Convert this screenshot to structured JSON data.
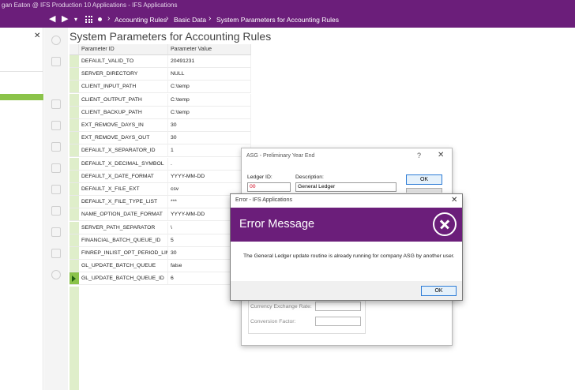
{
  "window": {
    "title": "gan Eaton @ IFS Production 10 Applications - IFS Applications"
  },
  "nav": {
    "breadcrumbs": [
      "Accounting Rules",
      "Basic Data",
      "System Parameters for Accounting Rules"
    ]
  },
  "page": {
    "title": "System Parameters for Accounting Rules"
  },
  "grid": {
    "columns": [
      "Parameter ID",
      "Parameter Value"
    ],
    "rows": [
      {
        "id": "DEFAULT_VALID_TO",
        "value": "20491231"
      },
      {
        "id": "SERVER_DIRECTORY",
        "value": "NULL"
      },
      {
        "id": "CLIENT_INPUT_PATH",
        "value": "C:\\temp"
      },
      {
        "id": "CLIENT_OUTPUT_PATH",
        "value": "C:\\temp"
      },
      {
        "id": "CLIENT_BACKUP_PATH",
        "value": "C:\\temp"
      },
      {
        "id": "EXT_REMOVE_DAYS_IN",
        "value": "30"
      },
      {
        "id": "EXT_REMOVE_DAYS_OUT",
        "value": "30"
      },
      {
        "id": "DEFAULT_X_SEPARATOR_ID",
        "value": "1"
      },
      {
        "id": "DEFAULT_X_DECIMAL_SYMBOL",
        "value": "."
      },
      {
        "id": "DEFAULT_X_DATE_FORMAT",
        "value": "YYYY-MM-DD"
      },
      {
        "id": "DEFAULT_X_FILE_EXT",
        "value": "csv"
      },
      {
        "id": "DEFAULT_X_FILE_TYPE_LIST",
        "value": "***"
      },
      {
        "id": "NAME_OPTION_DATE_FORMAT",
        "value": "YYYY-MM-DD"
      },
      {
        "id": "SERVER_PATH_SEPARATOR",
        "value": "\\"
      },
      {
        "id": "FINANCIAL_BATCH_QUEUE_ID",
        "value": "5"
      },
      {
        "id": "FINREP_INLIST_OPT_PERIOD_LIMIT",
        "value": "30"
      },
      {
        "id": "GL_UPDATE_BATCH_QUEUE",
        "value": "false"
      },
      {
        "id": "GL_UPDATE_BATCH_QUEUE_ID",
        "value": "6"
      }
    ],
    "selected_row": 17
  },
  "year_end_dialog": {
    "title": "ASG - Preliminary Year End",
    "help": "?",
    "close": "✕",
    "ledger_label": "Ledger ID:",
    "ledger_value": "00",
    "description_label": "Description:",
    "description_value": "General Ledger",
    "ok_label": "OK",
    "rate_label": "Currency Exchange Rate:",
    "factor_label": "Conversion Factor:"
  },
  "error_dialog": {
    "title": "Error - IFS Applications",
    "close": "✕",
    "heading": "Error Message",
    "message": "The General Ledger update routine is already running for company ASG by another user.",
    "ok_label": "OK"
  },
  "leftpanel": {
    "close": "✕"
  },
  "colors": {
    "brand": "#6b1e7a",
    "accent_green": "#8bc34a",
    "row_indicator": "#dfeeca"
  }
}
